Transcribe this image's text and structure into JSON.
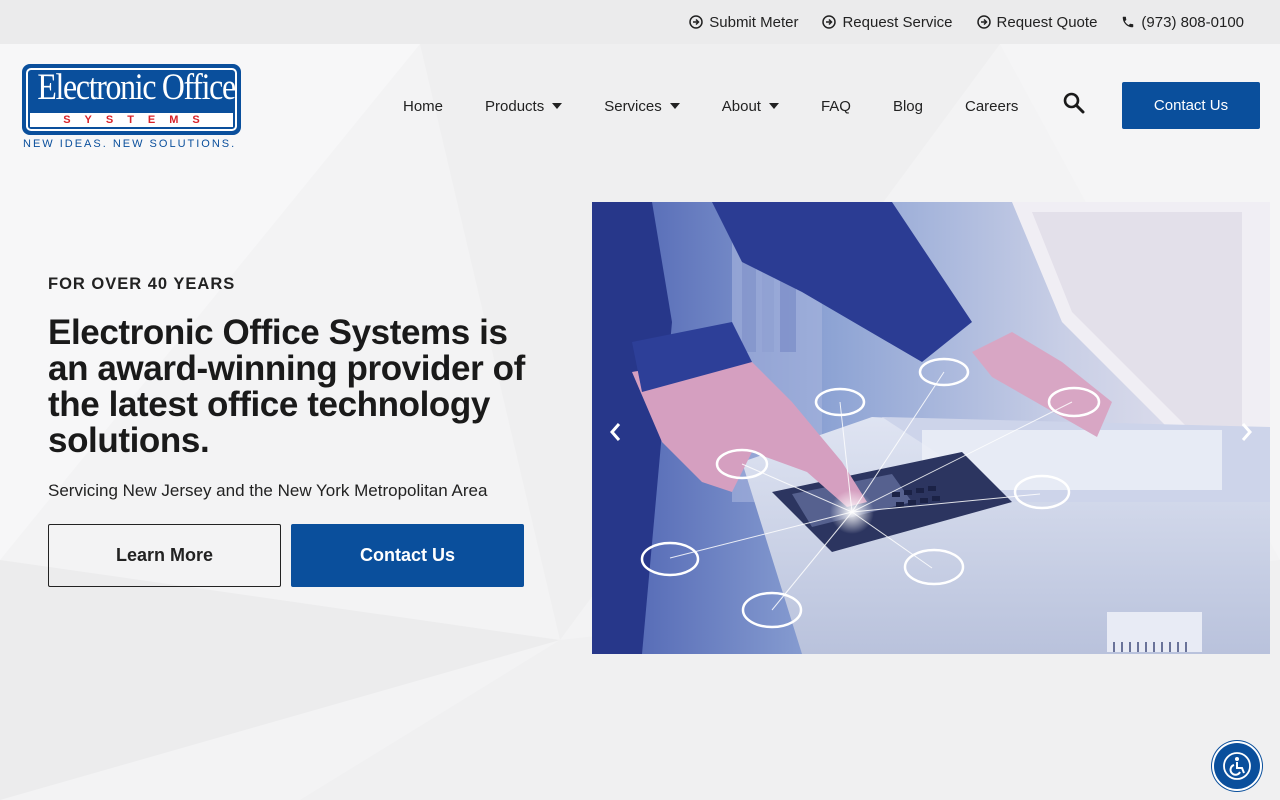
{
  "topbar": {
    "links": [
      {
        "label": "Submit Meter",
        "icon": "circle-arrow-right-icon"
      },
      {
        "label": "Request Service",
        "icon": "circle-arrow-right-icon"
      },
      {
        "label": "Request Quote",
        "icon": "circle-arrow-right-icon"
      }
    ],
    "phone": {
      "label": "(973) 808-0100",
      "icon": "phone-icon"
    }
  },
  "logo": {
    "title": "Electronic Office",
    "subtitle": "SYSTEMS",
    "tagline": "NEW IDEAS. NEW SOLUTIONS."
  },
  "nav": {
    "items": [
      {
        "label": "Home",
        "has_dropdown": false
      },
      {
        "label": "Products",
        "has_dropdown": true
      },
      {
        "label": "Services",
        "has_dropdown": true
      },
      {
        "label": "About",
        "has_dropdown": true
      },
      {
        "label": "FAQ",
        "has_dropdown": false
      },
      {
        "label": "Blog",
        "has_dropdown": false
      },
      {
        "label": "Careers",
        "has_dropdown": false
      }
    ],
    "search_icon": "search-icon",
    "cta_label": "Contact Us"
  },
  "hero": {
    "eyebrow": "FOR OVER 40 YEARS",
    "headline": "Electronic Office Systems is an award-winning provider of the latest office technology solutions.",
    "subline": "Servicing New Jersey and the New York Metropolitan Area",
    "secondary_button": "Learn More",
    "primary_button": "Contact Us"
  },
  "carousel": {
    "prev_icon": "chevron-left-icon",
    "next_icon": "chevron-right-icon"
  },
  "accessibility": {
    "icon": "accessibility-icon"
  },
  "colors": {
    "brand_blue": "#0a4f9c",
    "logo_red": "#d8232a",
    "topbar_bg": "#ebebec",
    "page_bg": "#f3f3f4"
  }
}
